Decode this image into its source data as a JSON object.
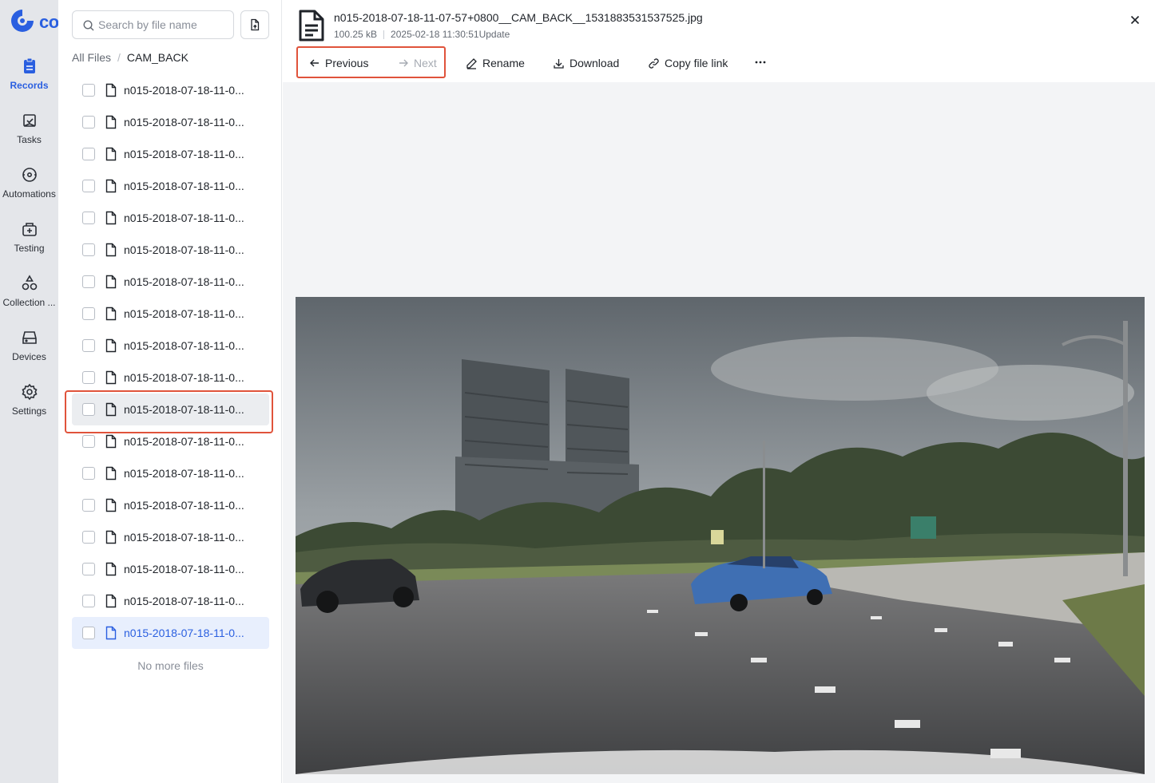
{
  "brand": {
    "name": "co",
    "color": "#2a5fe0"
  },
  "nav": [
    {
      "label": "Records",
      "icon": "records-icon",
      "active": true
    },
    {
      "label": "Tasks",
      "icon": "tasks-icon"
    },
    {
      "label": "Automations",
      "icon": "automations-icon"
    },
    {
      "label": "Testing",
      "icon": "testing-icon"
    },
    {
      "label": "Collection ...",
      "icon": "collection-icon"
    },
    {
      "label": "Devices",
      "icon": "devices-icon"
    },
    {
      "label": "Settings",
      "icon": "settings-icon"
    }
  ],
  "search": {
    "placeholder": "Search by file name",
    "value": ""
  },
  "breadcrumb": {
    "root": "All Files",
    "separator": "/",
    "current": "CAM_BACK"
  },
  "files": [
    "n015-2018-07-18-11-0...",
    "n015-2018-07-18-11-0...",
    "n015-2018-07-18-11-0...",
    "n015-2018-07-18-11-0...",
    "n015-2018-07-18-11-0...",
    "n015-2018-07-18-11-0...",
    "n015-2018-07-18-11-0...",
    "n015-2018-07-18-11-0...",
    "n015-2018-07-18-11-0...",
    "n015-2018-07-18-11-0...",
    "n015-2018-07-18-11-0...",
    "n015-2018-07-18-11-0...",
    "n015-2018-07-18-11-0...",
    "n015-2018-07-18-11-0...",
    "n015-2018-07-18-11-0...",
    "n015-2018-07-18-11-0...",
    "n015-2018-07-18-11-0...",
    "n015-2018-07-18-11-0..."
  ],
  "hovered_file_index": 10,
  "current_file_index": 17,
  "no_more_files": "No more files",
  "preview": {
    "file_name": "n015-2018-07-18-11-07-57+0800__CAM_BACK__1531883531537525.jpg",
    "size": "100.25 kB",
    "updated": "2025-02-18 11:30:51Update",
    "previous_label": "Previous",
    "next_label": "Next",
    "rename_label": "Rename",
    "download_label": "Download",
    "copy_link_label": "Copy file link",
    "more_icon": "ellipsis-icon",
    "close_icon": "close-icon"
  },
  "colors": {
    "accent": "#2a5fe0",
    "highlight_outline": "#e0533b",
    "nav_bg": "#e4e6ea"
  }
}
